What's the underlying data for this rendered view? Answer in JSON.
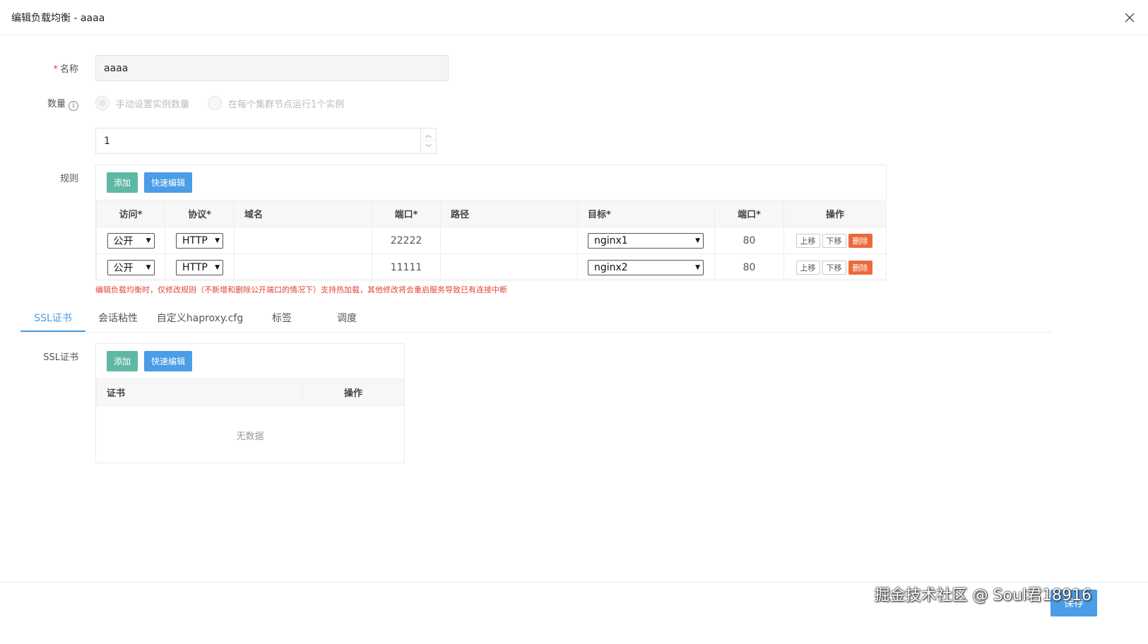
{
  "dialog": {
    "title": "编辑负载均衡 - aaaa"
  },
  "name_field": {
    "label": "名称",
    "required_mark": "*",
    "value": "aaaa"
  },
  "quantity": {
    "label": "数量",
    "info_glyph": "i",
    "option_manual": "手动设置实例数量",
    "option_per_node": "在每个集群节点运行1个实例",
    "value": "1"
  },
  "rules": {
    "label": "规则",
    "add_label": "添加",
    "quick_edit_label": "快速编辑",
    "columns": [
      "访问*",
      "协议*",
      "域名",
      "端口*",
      "路径",
      "目标*",
      "端口*",
      "操作"
    ],
    "rows": [
      {
        "access": "公开",
        "protocol": "HTTP",
        "domain": "",
        "port": "22222",
        "path": "",
        "target": "nginx1",
        "target_port": "80"
      },
      {
        "access": "公开",
        "protocol": "HTTP",
        "domain": "",
        "port": "11111",
        "path": "",
        "target": "nginx2",
        "target_port": "80"
      }
    ],
    "action_up": "上移",
    "action_down": "下移",
    "action_delete": "删除",
    "warning": "编辑负载均衡时，仅修改规则（不新增和删除公开端口的情况下）支持热加载，其他修改将会重启服务导致已有连接中断"
  },
  "tabs": [
    "SSL证书",
    "会话粘性",
    "自定义haproxy.cfg",
    "标签",
    "调度"
  ],
  "ssl": {
    "label": "SSL证书",
    "add_label": "添加",
    "quick_edit_label": "快速编辑",
    "columns": [
      "证书",
      "操作"
    ],
    "empty_text": "无数据"
  },
  "footer": {
    "save_label": "保存",
    "watermark": "掘金技术社区 @ Soul君18916"
  },
  "icons": {
    "close": "close-icon",
    "info": "info-icon",
    "select_arrow": "chevron-down-icon"
  },
  "colors": {
    "primary": "#4a9de6",
    "success": "#5fb8a6",
    "danger": "#ea6a3a",
    "warning_text": "#e0443c"
  }
}
